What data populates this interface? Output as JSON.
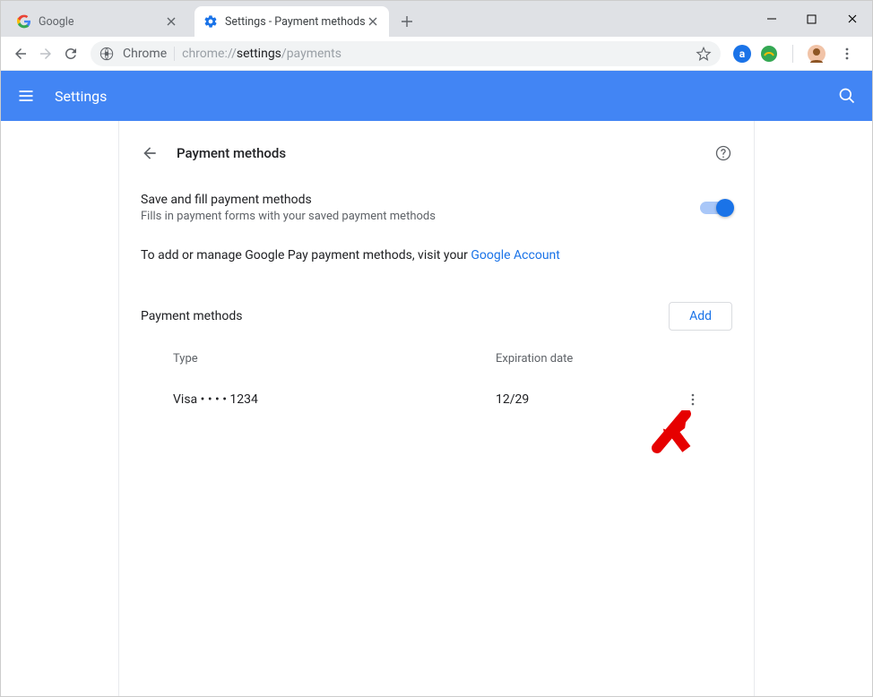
{
  "window": {
    "tabs": [
      {
        "title": "Google",
        "active": false
      },
      {
        "title": "Settings - Payment methods",
        "active": true
      }
    ]
  },
  "omnibox": {
    "prefix_label": "Chrome",
    "url_scheme": "chrome://",
    "url_bold": "settings",
    "url_rest": "/payments"
  },
  "settings_header": {
    "title": "Settings"
  },
  "page": {
    "title": "Payment methods",
    "toggle": {
      "primary": "Save and fill payment methods",
      "secondary": "Fills in payment forms with your saved payment methods",
      "on": true
    },
    "info_text": "To add or manage Google Pay payment methods, visit your ",
    "info_link": "Google Account",
    "section_title": "Payment methods",
    "add_button": "Add",
    "columns": {
      "type": "Type",
      "expiration": "Expiration date"
    },
    "rows": [
      {
        "type": "Visa  • • • • 1234",
        "expiration": "12/29"
      }
    ]
  }
}
